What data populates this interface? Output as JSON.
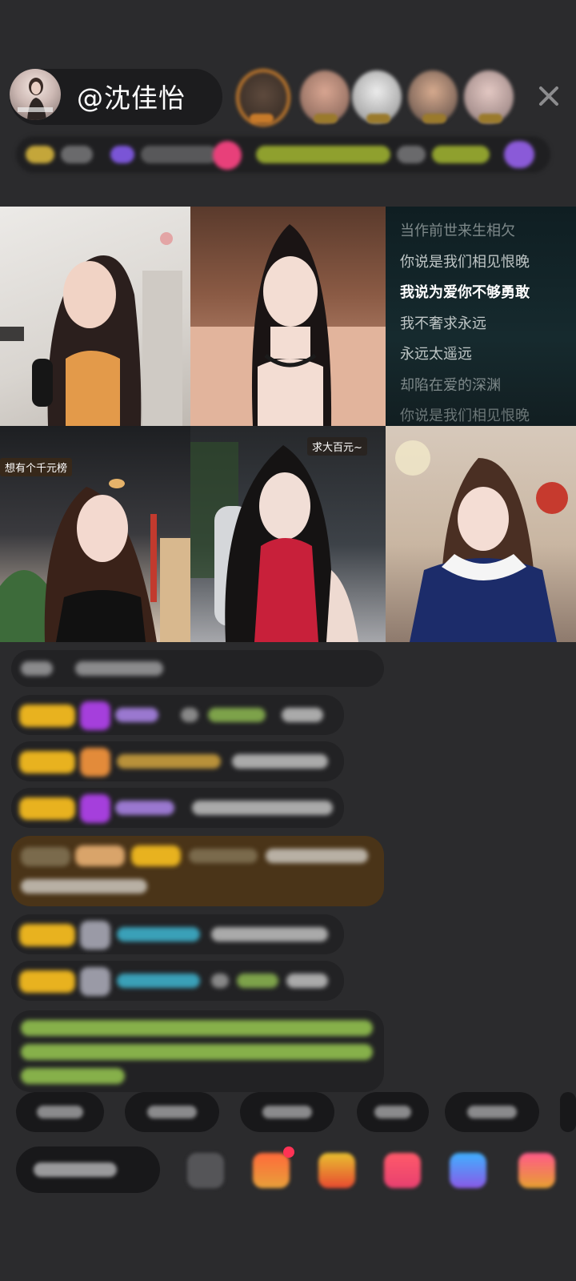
{
  "header": {
    "host_name": "@沈佳怡",
    "close_label": "×"
  },
  "video_grid": {
    "lyrics": [
      "当作前世来生相欠",
      "你说是我们相见恨晚",
      "我说为爱你不够勇敢",
      "我不奢求永远",
      "永远太遥远",
      "却陷在爱的深渊",
      "你说是我们相见恨晚"
    ],
    "tile4_tag": "想有个千元榜",
    "tile5_tag": "求大百元~"
  },
  "colors": {
    "level_badge": "#e8b21f",
    "accent_pink": "#e8407a",
    "chat_bg": "#222224",
    "highlight_msg_bg": "#4a3418",
    "lyric_active": "#ffffff"
  },
  "icons": {
    "close": "close-icon",
    "gift_box": "gift-box-icon",
    "red_packet": "red-packet-icon",
    "heart": "heart-icon",
    "game_controller": "game-controller-icon",
    "grid": "grid-icon",
    "emoji": "emoji-icon"
  }
}
